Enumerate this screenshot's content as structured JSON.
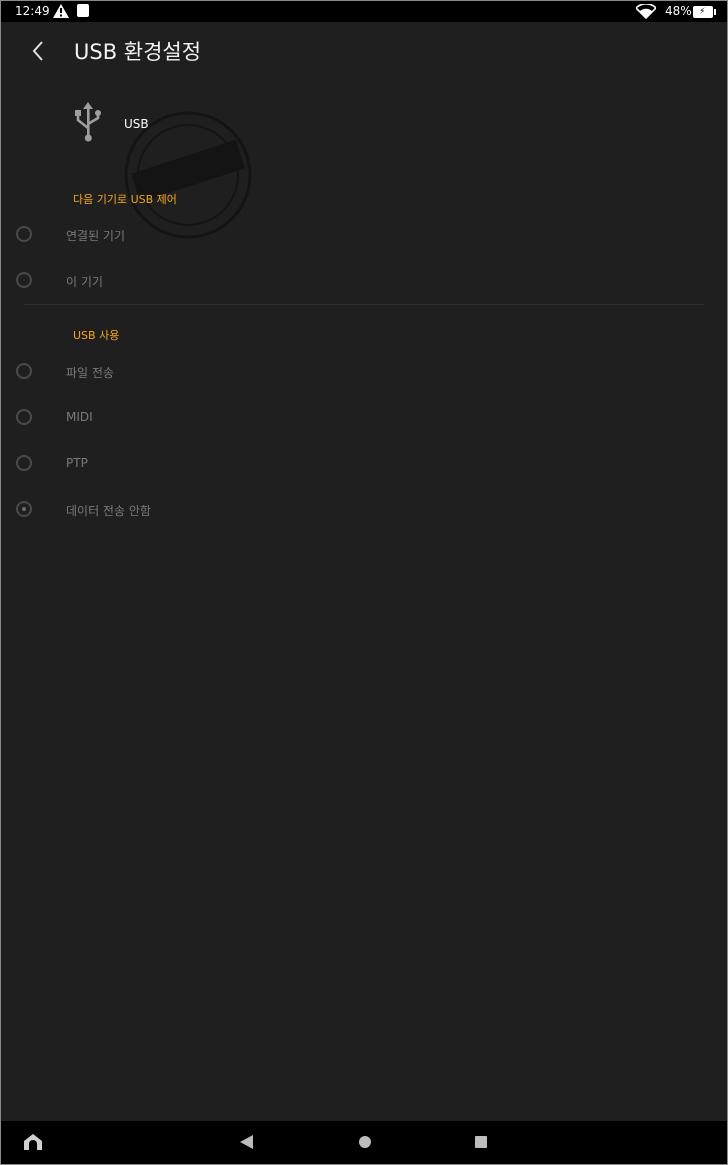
{
  "status_bar": {
    "time": "12:49",
    "battery_percent": "48%",
    "icons": [
      "warning-icon",
      "puzzle-icon",
      "wifi-icon",
      "battery-charging-icon"
    ]
  },
  "app_bar": {
    "title": "USB 환경설정"
  },
  "usb_header": {
    "label": "USB",
    "icon": "usb-icon"
  },
  "control_section": {
    "title": "다음 기기로 USB 제어",
    "options": [
      {
        "label": "연결된 기기",
        "selected": false
      },
      {
        "label": "이 기기",
        "selected": false
      }
    ]
  },
  "usage_section": {
    "title": "USB 사용",
    "options": [
      {
        "label": "파일 전송",
        "selected": false
      },
      {
        "label": "MIDI",
        "selected": false
      },
      {
        "label": "PTP",
        "selected": false
      },
      {
        "label": "데이터 전송 안함",
        "selected": true
      }
    ]
  },
  "colors": {
    "background": "#1f1f1f",
    "accent": "#f5a623",
    "bars": "#000000"
  }
}
